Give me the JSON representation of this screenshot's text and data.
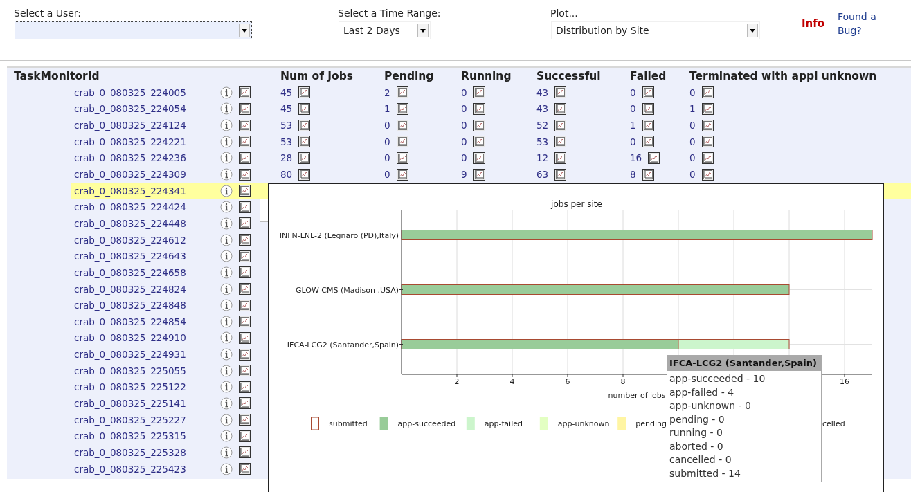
{
  "filters": [
    {
      "label": "Select a User:",
      "focused": true
    },
    {
      "label": "Select a Time Range:",
      "value": "Last 2 Days",
      "focused": false
    },
    {
      "label": "Plot...",
      "value": "Distribution by Site",
      "focused": false
    }
  ],
  "info_link": "Info",
  "bug_link": "Found a Bug?",
  "table": {
    "columns": [
      "TaskMonitorId",
      "Num of Jobs",
      "Pending",
      "Running",
      "Successful",
      "Failed",
      "Terminated with appl unknown"
    ],
    "rows": [
      {
        "id": "crab_0_080325_224005",
        "selected": false,
        "cells": [
          "45",
          "2",
          "0",
          "43",
          "0",
          "0"
        ]
      },
      {
        "id": "crab_0_080325_224054",
        "selected": false,
        "cells": [
          "45",
          "1",
          "0",
          "43",
          "0",
          "1"
        ]
      },
      {
        "id": "crab_0_080325_224124",
        "selected": false,
        "cells": [
          "53",
          "0",
          "0",
          "52",
          "1",
          "0"
        ]
      },
      {
        "id": "crab_0_080325_224221",
        "selected": false,
        "cells": [
          "53",
          "0",
          "0",
          "53",
          "0",
          "0"
        ]
      },
      {
        "id": "crab_0_080325_224236",
        "selected": false,
        "cells": [
          "28",
          "0",
          "0",
          "12",
          "16",
          "0"
        ]
      },
      {
        "id": "crab_0_080325_224309",
        "selected": false,
        "cells": [
          "80",
          "0",
          "9",
          "63",
          "8",
          "0"
        ]
      },
      {
        "id": "crab_0_080325_224341",
        "selected": true
      },
      {
        "id": "crab_0_080325_224424",
        "selected": false
      },
      {
        "id": "crab_0_080325_224448",
        "selected": false
      },
      {
        "id": "crab_0_080325_224612",
        "selected": false
      },
      {
        "id": "crab_0_080325_224643",
        "selected": false
      },
      {
        "id": "crab_0_080325_224658",
        "selected": false
      },
      {
        "id": "crab_0_080325_224824",
        "selected": false
      },
      {
        "id": "crab_0_080325_224848",
        "selected": false
      },
      {
        "id": "crab_0_080325_224854",
        "selected": false
      },
      {
        "id": "crab_0_080325_224910",
        "selected": false
      },
      {
        "id": "crab_0_080325_224931",
        "selected": false
      },
      {
        "id": "crab_0_080325_225055",
        "selected": false
      },
      {
        "id": "crab_0_080325_225122",
        "selected": false
      },
      {
        "id": "crab_0_080325_225141",
        "selected": false
      },
      {
        "id": "crab_0_080325_225227",
        "selected": false
      },
      {
        "id": "crab_0_080325_225315",
        "selected": false
      },
      {
        "id": "crab_0_080325_225328",
        "selected": false
      },
      {
        "id": "crab_0_080325_225423",
        "selected": false
      }
    ]
  },
  "partial_panel": {
    "visible": true
  },
  "plot": {
    "chart_data": {
      "type": "bar",
      "orientation": "horizontal",
      "stacked": true,
      "title": "jobs per site",
      "xlabel": "number of jobs",
      "categories": [
        "INFN-LNL-2 (Legnaro (PD),Italy)",
        "GLOW-CMS (Madison ,USA)",
        "IFCA-LCG2 (Santander,Spain)"
      ],
      "series": [
        {
          "name": "app-succeeded",
          "color": "#99cc99",
          "values": [
            17,
            14,
            10
          ]
        },
        {
          "name": "app-failed",
          "color": "#ccf5cc",
          "values": [
            0,
            0,
            4
          ]
        },
        {
          "name": "app-unknown",
          "color": "#e3ffc2",
          "values": [
            0,
            0,
            0
          ]
        },
        {
          "name": "pending",
          "color": "#fff5a3",
          "values": [
            0,
            0,
            0
          ]
        }
      ],
      "xlim": [
        0,
        17
      ],
      "xticks": [
        {
          "value": 2,
          "label": "2"
        },
        {
          "value": 4,
          "label": "4"
        },
        {
          "value": 6,
          "label": "6"
        },
        {
          "value": 8,
          "label": "8"
        },
        {
          "value": 16,
          "label": "16"
        }
      ],
      "grid": true,
      "legend": true
    },
    "outline_legend": {
      "name": "submitted",
      "color": "#a84a32"
    },
    "legend_cut_label": "celled",
    "tooltip": {
      "title": "IFCA-LCG2 (Santander,Spain)",
      "lines": [
        "app-succeeded - 10",
        "app-failed - 4",
        "app-unknown - 0",
        "pending - 0",
        "running - 0",
        "aborted - 0",
        "cancelled - 0",
        "submitted - 14"
      ]
    }
  }
}
